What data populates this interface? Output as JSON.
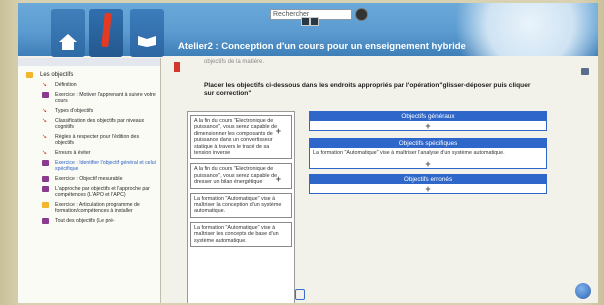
{
  "header": {
    "search_value": "Rechercher",
    "title": "Atelier2 : Conception d'un cours pour un enseignement hybride"
  },
  "sidebar": {
    "items": [
      {
        "label": "Les objectifs",
        "icon": "folder-icon",
        "root": true
      },
      {
        "label": "Définition",
        "icon": "arrow-icon"
      },
      {
        "label": "Exercice : Motiver l'apprenant à suivre votre cours",
        "icon": "exercise-icon"
      },
      {
        "label": "Types d'objectifs",
        "icon": "arrow-icon"
      },
      {
        "label": "Classification des objectifs par niveaux cognitifs",
        "icon": "arrow-icon"
      },
      {
        "label": "Règles à respecter pour l'édition des objectifs",
        "icon": "arrow-icon"
      },
      {
        "label": "Erreurs à éviter",
        "icon": "arrow-icon"
      },
      {
        "label": "Exercice : Identifier l'objectif général et celui spécifique",
        "icon": "exercise-icon",
        "active": true
      },
      {
        "label": "Exercice : Objectif mesurable",
        "icon": "exercise-icon"
      },
      {
        "label": "L'approche par objectifs et l'approche par compétences (L'APO et l'APC)",
        "icon": "exercise-icon"
      },
      {
        "label": "Exercice : Articulation programme de formation/compétences à installer",
        "icon": "folder-icon"
      },
      {
        "label": "Tout des objectifs (Le pré-",
        "icon": "exercise-icon"
      }
    ]
  },
  "main": {
    "faded_text": "objectifs de la matière.",
    "instruction": "Placer les objectifs ci-dessous dans les endroits appropriés par l'opération\"glisser-déposer puis cliquer sur correction\"",
    "drag_items": [
      "A la fin du cours \"Electronique de puissance\", vous serez capable de dimensionner les composants de puissance dans un convertisseur statique à travers le tracé de sa tension inverse",
      "A la fin du cours \"Electronique de puissance\", vous serez capable de dresser un bilan énergétique",
      "La formation \"Automatique\" vise à maîtriser la conception d'un système automatique.",
      "La formation \"Automatique\" vise à maîtriser les concepts de base d'un système automatique."
    ],
    "zones": [
      {
        "title": "Objectifs généraux",
        "items": []
      },
      {
        "title": "Objectifs spécifiques",
        "items": [
          "La formation \"Automatique\" vise à maîtriser l'analyse d'un système automatique."
        ]
      },
      {
        "title": "Objectifs erronés",
        "items": []
      }
    ],
    "add_glyph": "+"
  },
  "colors": {
    "header": "#5b9bd0",
    "zone_accent": "#2e67c9",
    "link_active": "#2d5fc4"
  }
}
